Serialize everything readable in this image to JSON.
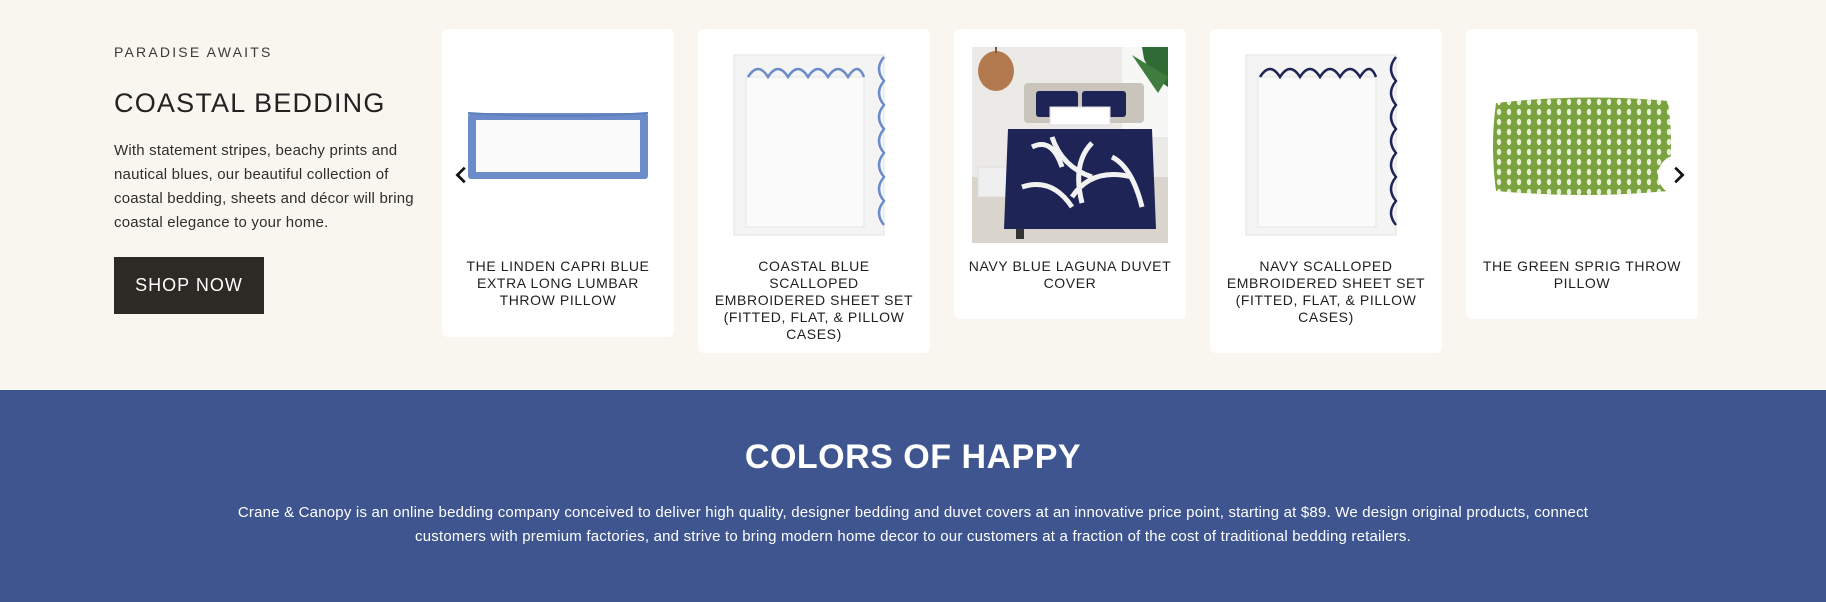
{
  "intro": {
    "eyebrow": "PARADISE AWAITS",
    "title": "COASTAL BEDDING",
    "text": "With statement stripes, beachy prints and nautical blues, our beautiful collection of coastal bedding, sheets and décor will bring coastal elegance to your home.",
    "cta": "SHOP NOW"
  },
  "carousel": {
    "prev_icon": "chevron-left-icon",
    "next_icon": "chevron-right-icon",
    "products": [
      {
        "label": "THE LINDEN CAPRI BLUE EXTRA LONG LUMBAR THROW PILLOW"
      },
      {
        "label": "COASTAL BLUE SCALLOPED EMBROIDERED SHEET SET (FITTED, FLAT, & PILLOW CASES)"
      },
      {
        "label": "NAVY BLUE LAGUNA DUVET COVER"
      },
      {
        "label": "NAVY SCALLOPED EMBROIDERED SHEET SET (FITTED, FLAT, & PILLOW CASES)"
      },
      {
        "label": "THE GREEN SPRIG THROW PILLOW"
      }
    ]
  },
  "about": {
    "title": "COLORS OF HAPPY",
    "text": "Crane & Canopy is an online bedding company conceived to deliver high quality, designer bedding and duvet covers at an innovative price point, starting at $89. We design original products, connect customers with premium factories, and strive to bring modern home decor to our customers at a fraction of the cost of traditional bedding retailers."
  },
  "colors": {
    "page_bg": "#f9f6f0",
    "button_bg": "#2d2a26",
    "band_bg": "#3e5590",
    "capri_blue": "#6b8cc8",
    "navy": "#1e2455",
    "green": "#7aa33f"
  }
}
